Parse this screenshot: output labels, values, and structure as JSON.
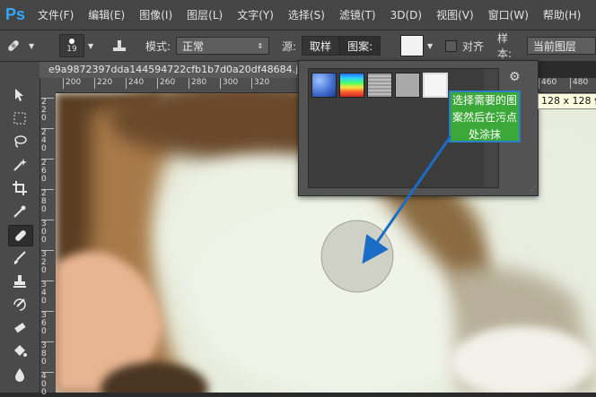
{
  "app": {
    "logo": "Ps",
    "menu": [
      "文件(F)",
      "编辑(E)",
      "图像(I)",
      "图层(L)",
      "文字(Y)",
      "选择(S)",
      "滤镜(T)",
      "3D(D)",
      "视图(V)",
      "窗口(W)",
      "帮助(H)"
    ]
  },
  "options": {
    "brush_size": "19",
    "mode_label": "模式:",
    "mode_value": "正常",
    "source_label": "源:",
    "source_sample": "取样",
    "source_pattern": "图案:",
    "aligned_label": "对齐",
    "sample_label": "样本:",
    "sample_value": "当前图层"
  },
  "document": {
    "tab_title": "e9a9872397dda144594722cfb1b7d0a20df48684.j"
  },
  "rulers": {
    "horizontal": [
      "200",
      "220",
      "240",
      "260",
      "280",
      "300",
      "320",
      "460",
      "480"
    ],
    "vertical": [
      "220",
      "240",
      "260",
      "280",
      "300",
      "320",
      "340",
      "360",
      "380",
      "400"
    ]
  },
  "pattern_picker": {
    "patterns": [
      "blue-bubbles-pattern",
      "rainbow-pattern",
      "gray-noise-pattern",
      "gray-pattern",
      "white-pattern"
    ],
    "selected_index": 4,
    "tooltip": "128 x 128 像"
  },
  "annotation": {
    "text": "选择需要的图案然后在污点处涂抹",
    "color": "#3da83a",
    "border_color": "#2a7fc7",
    "arrow_color": "#1a6dc6"
  },
  "tools": [
    "move-tool",
    "marquee-tool",
    "lasso-tool",
    "magic-wand-tool",
    "crop-tool",
    "eyedropper-tool",
    "healing-brush-tool",
    "brush-tool",
    "clone-stamp-tool",
    "history-brush-tool",
    "eraser-tool",
    "paint-bucket-tool",
    "blur-tool"
  ],
  "active_tool": "healing-brush-tool"
}
